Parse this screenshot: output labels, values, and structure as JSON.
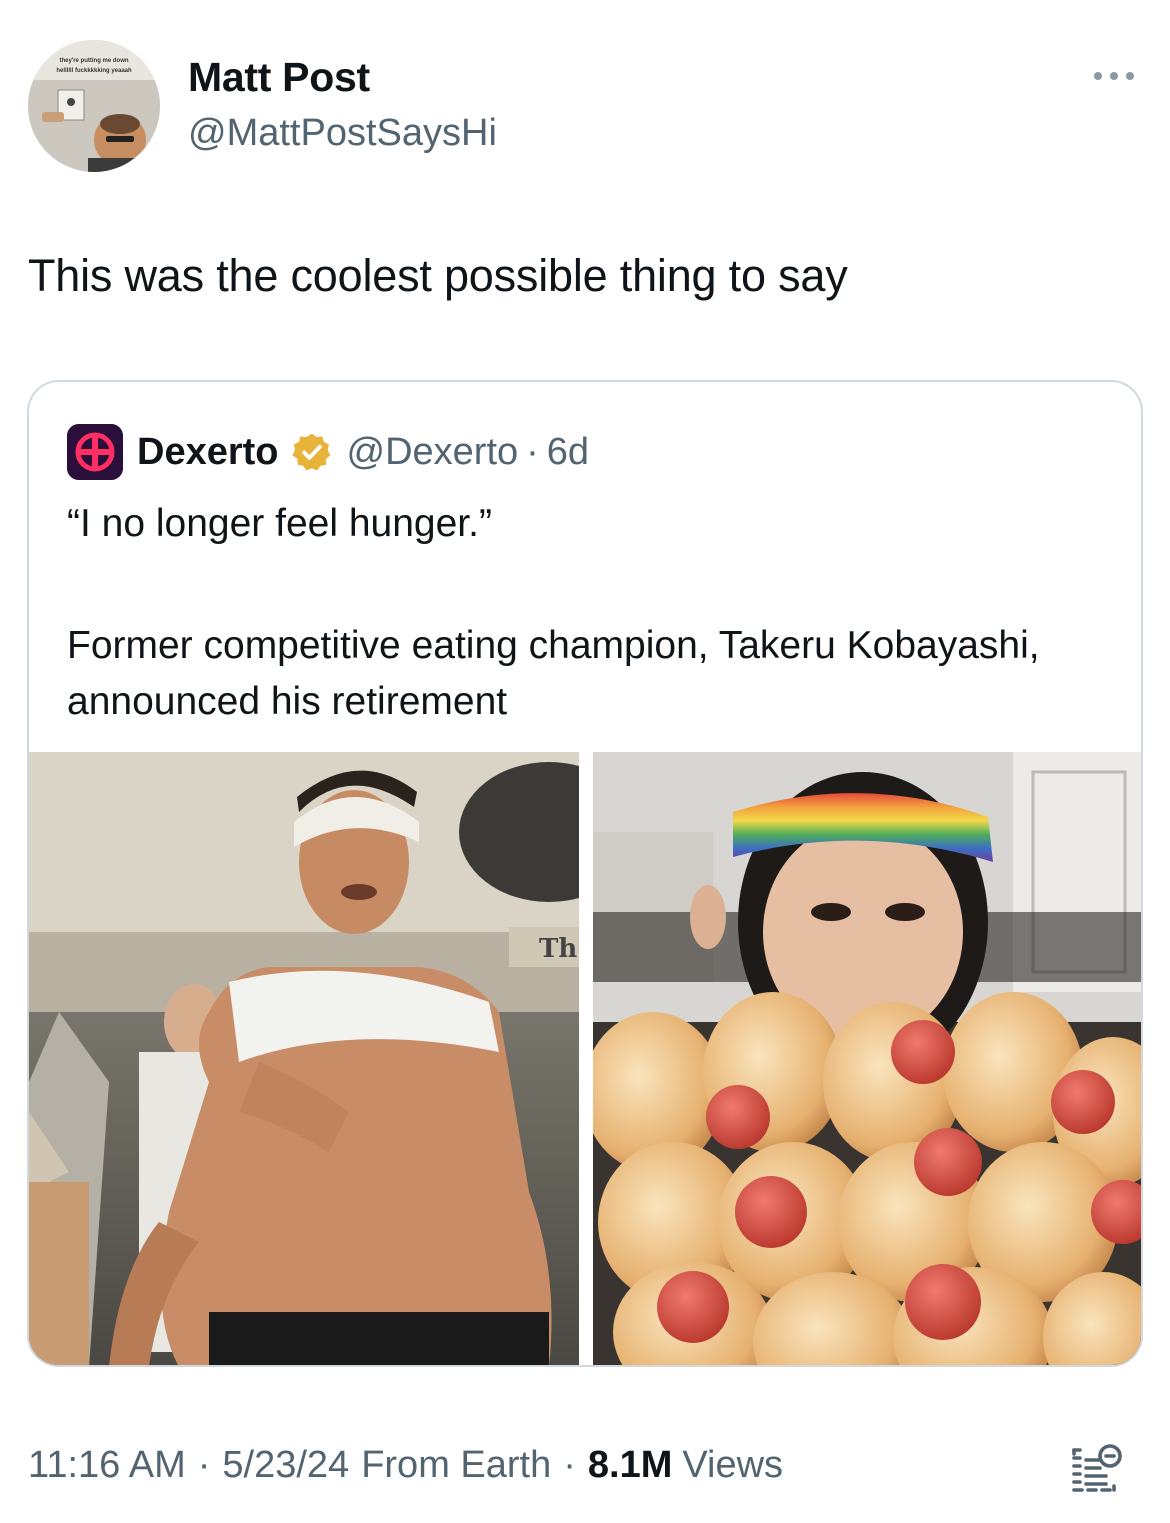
{
  "author": {
    "display_name": "Matt Post",
    "handle": "@MattPostSaysHi",
    "avatar_caption": "they're putting me down hellllll fuckkkkking yeaaah"
  },
  "more_icon": "more-horizontal-icon",
  "tweet_text": "This was the coolest possible thing to say",
  "quoted": {
    "display_name": "Dexerto",
    "verified": "gold-verified-badge",
    "handle": "@Dexerto",
    "separator": "·",
    "time": "6d",
    "text_quote": "“I no longer feel hunger.”",
    "text_body": "Former competitive eating champion, Takeru Kobayashi, announced his retirement",
    "photo_left_overlay": "Th",
    "photos": [
      "photo-kobayashi-stage",
      "photo-kobayashi-hotdogs"
    ]
  },
  "footer": {
    "time": "11:16 AM",
    "separator": "·",
    "date": "5/23/24",
    "source": "From Earth",
    "views_count": "8.1M",
    "views_label": "Views",
    "analytics_icon": "view-analytics-icon"
  },
  "colors": {
    "text_primary": "#0f1419",
    "text_secondary": "#536471",
    "border": "#cfd9de",
    "verified_gold": "#e8b33a"
  }
}
